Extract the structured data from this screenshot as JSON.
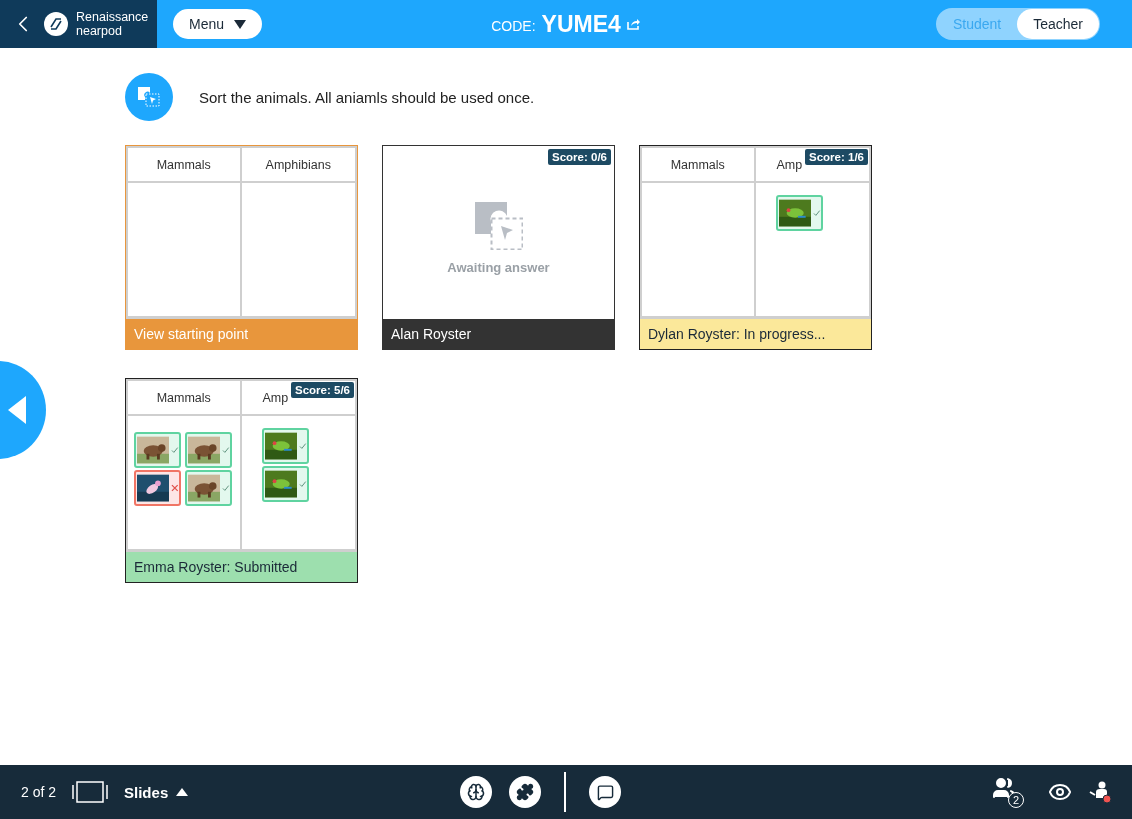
{
  "header": {
    "logo_lines": [
      "Renaissance",
      "nearpod"
    ],
    "menu_button": "Menu",
    "code_label": "CODE:",
    "code": "YUME4",
    "modes": [
      {
        "label": "Student",
        "selected": false
      },
      {
        "label": "Teacher",
        "selected": true
      }
    ]
  },
  "question": {
    "text": "Sort the animals. All aniamls should be used once."
  },
  "cards": [
    {
      "kind": "board",
      "columns": [
        {
          "header": "Mammals"
        },
        {
          "header": "Amphibians"
        }
      ],
      "footer": {
        "text": "View starting point",
        "color": "#e8963c"
      }
    },
    {
      "kind": "awaiting",
      "score": "Score: 0/6",
      "message": "Awaiting answer",
      "footer": {
        "text": "Alan Royster",
        "color": "#333333"
      }
    },
    {
      "kind": "board",
      "score": "Score: 1/6",
      "columns": [
        {
          "header": "Mammals"
        },
        {
          "header": "Amp",
          "items": [
            {
              "correct": true
            }
          ]
        }
      ],
      "footer": {
        "text": "Dylan Royster: In progress...",
        "color": "#fbe89a"
      }
    },
    {
      "kind": "board",
      "score": "Score: 5/6",
      "columns": [
        {
          "header": "Mammals",
          "items": [
            {
              "correct": true
            },
            {
              "correct": true
            },
            {
              "correct": false
            },
            {
              "correct": true
            }
          ]
        },
        {
          "header": "Amp",
          "items": [
            {
              "correct": true
            },
            {
              "correct": true
            }
          ]
        }
      ],
      "footer": {
        "text": "Emma Royster: Submitted",
        "color": "#9ddfae"
      }
    }
  ],
  "bottom_bar": {
    "position": "2 of 2",
    "slides_label": "Slides",
    "participants_count": "2"
  }
}
